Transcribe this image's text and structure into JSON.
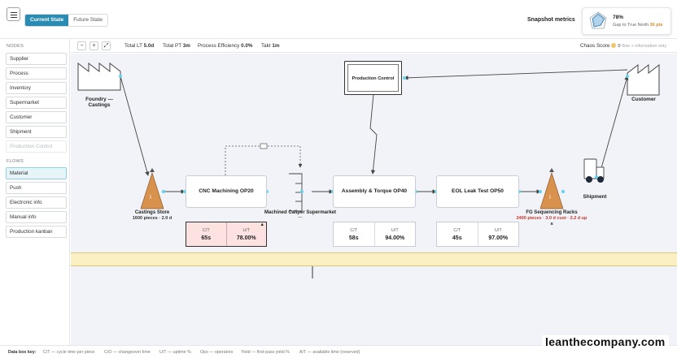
{
  "header": {
    "menu_icon": "hamburger-icon",
    "state_tabs": [
      "Current State",
      "Future State"
    ],
    "snapshot_title": "Snapshot metrics",
    "snapshot_percent": "78%",
    "snapshot_gap_label": "Gap to True North",
    "snapshot_gap_value": "30 pts"
  },
  "sidebar": {
    "nodes_heading": "NODES",
    "nodes": [
      "Supplier",
      "Process",
      "Inventory",
      "Supermarket",
      "Customer",
      "Shipment",
      "Production Control"
    ],
    "flows_heading": "FLOWS",
    "flows": [
      "Material",
      "Push",
      "Electronic info",
      "Manual info",
      "Production kanban"
    ]
  },
  "toolbar": {
    "zoom_out": "−",
    "zoom_in": "+",
    "fit": "⤢",
    "total_lt_label": "Total LT",
    "total_lt": "5.0d",
    "total_pt_label": "Total PT",
    "total_pt": "3m",
    "efficiency_label": "Process Efficiency",
    "efficiency": "0.0%",
    "takt_label": "Takt",
    "takt": "1m",
    "chaos_label": "Chaos Score",
    "chaos_value": "0",
    "chaos_note": "flow + information only"
  },
  "map": {
    "supplier": "Foundry — Castings",
    "customer": "Customer",
    "production_control": "Production Control",
    "shipment": "Shipment",
    "inv1": {
      "name": "Castings Store",
      "detail": "1600 pieces · 2.0 d"
    },
    "inv2": {
      "name": "FG Sequencing Racks",
      "detail": "2400 pieces · 3.0 d cust · 2.2 d up",
      "marker": "a"
    },
    "supermarket": "Machined Caliper Supermarket",
    "supermarket_sub": "—",
    "inventory_glyph": "I",
    "processes": [
      {
        "name": "CNC Machining OP20",
        "ct_label": "C/T",
        "ct": "65s",
        "ut_label": "U/T",
        "ut": "78.00%",
        "alert": "▲"
      },
      {
        "name": "Assembly & Torque OP40",
        "ct_label": "C/T",
        "ct": "58s",
        "ut_label": "U/T",
        "ut": "94.00%"
      },
      {
        "name": "EOL Leak Test OP50",
        "ct_label": "C/T",
        "ct": "45s",
        "ut_label": "U/T",
        "ut": "97.00%"
      }
    ]
  },
  "footer": {
    "key_title": "Data box key:",
    "items": [
      "C/T — cycle time per piece",
      "C/O — changeover time",
      "U/T — uptime %",
      "Ops — operators",
      "Yield — first-pass yield %",
      "A/T — available time (reserved)"
    ]
  },
  "watermark": "leanthecompany.com",
  "colors": {
    "accent": "#2a8bb3",
    "inventory": "#d9914e",
    "alert_fill": "#fde2e2",
    "timeline": "#fbf0c4",
    "connector": "#5fd3e8"
  }
}
